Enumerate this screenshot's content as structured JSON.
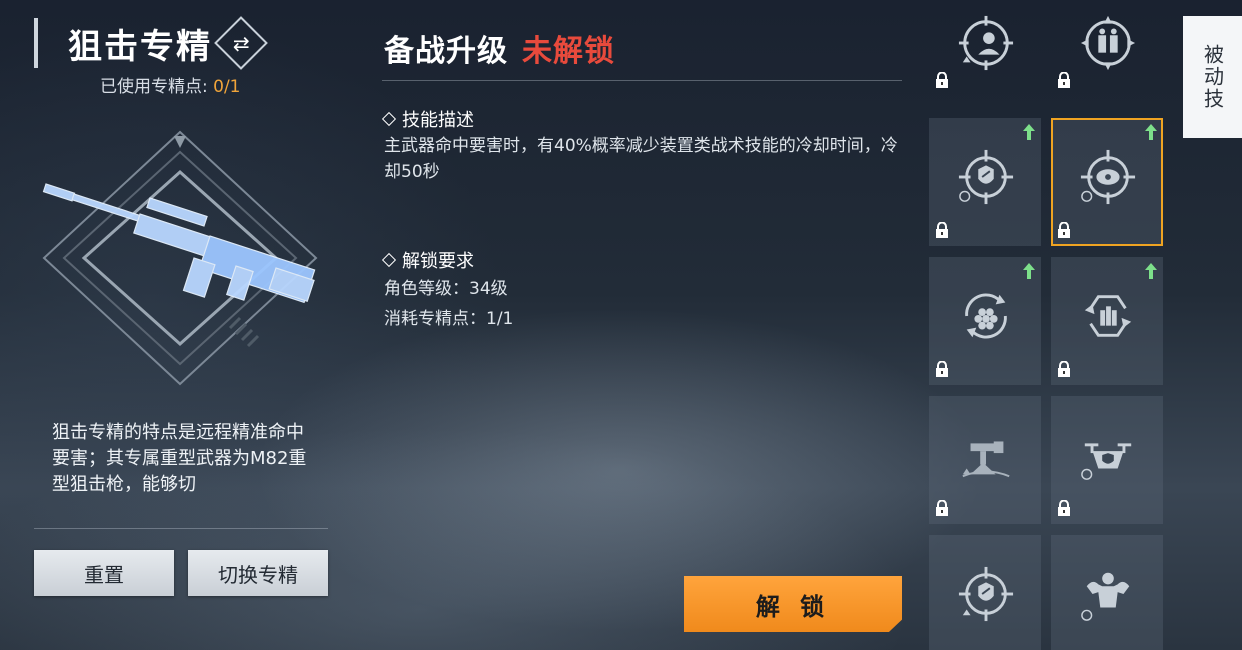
{
  "specialization": {
    "title": "狙击专精",
    "switch_icon": "swap-arrows-icon",
    "points_label": "已使用专精点:",
    "points_value": "0/1",
    "description": "狙击专精的特点是远程精准命中要害；其专属重型武器为M82重型狙击枪，能够切",
    "weapon_image": "m82-sniper-rifle-hologram"
  },
  "buttons": {
    "reset": "重置",
    "switch_spec": "切换专精",
    "unlock": "解 锁"
  },
  "upgrade": {
    "title": "备战升级",
    "status": "未解锁",
    "status_color": "#e84a3c",
    "skill_desc_header": "技能描述",
    "skill_desc": "主武器命中要害时，有40%概率减少装置类战术技能的冷却时间，冷却50秒",
    "unlock_req_header": "解锁要求",
    "req_level": "角色等级：34级",
    "req_points": "消耗专精点：1/1"
  },
  "passive_tab": {
    "label": "被动技"
  },
  "skills": [
    {
      "icon": "crosshair-person-icon",
      "locked": true,
      "upgrade": false
    },
    {
      "icon": "crosshair-team-icon",
      "locked": true,
      "upgrade": false
    },
    {
      "icon": "crosshair-shield-icon",
      "locked": true,
      "upgrade": true
    },
    {
      "icon": "crosshair-device-icon",
      "locked": true,
      "upgrade": true,
      "selected": true
    },
    {
      "icon": "rotate-hex-icon",
      "locked": true,
      "upgrade": true
    },
    {
      "icon": "ammo-refresh-icon",
      "locked": true,
      "upgrade": true
    },
    {
      "icon": "turret-icon",
      "locked": true,
      "upgrade": false
    },
    {
      "icon": "drone-icon",
      "locked": true,
      "upgrade": false
    },
    {
      "icon": "crosshair-shield-icon",
      "locked": false,
      "upgrade": false
    },
    {
      "icon": "muscle-icon",
      "locked": false,
      "upgrade": false
    }
  ],
  "colors": {
    "accent": "#f0a43a",
    "unlock_button": "#f59a2a",
    "upgrade_arrow": "#7de08a",
    "selected_border": "#f0a422"
  }
}
